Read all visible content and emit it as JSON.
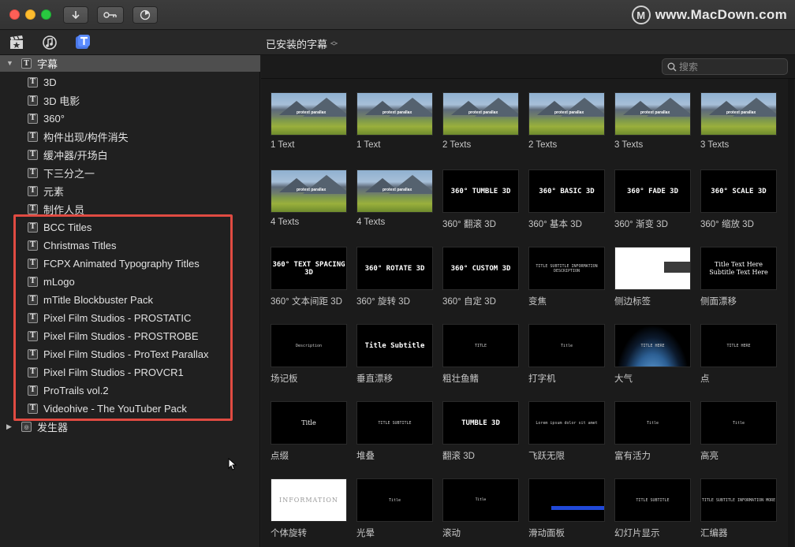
{
  "window": {
    "brand_logo": "M",
    "brand_text": "www.MacDown.com"
  },
  "toolbar": {
    "icons": [
      "download-arrow-icon",
      "key-icon",
      "progress-dial-icon"
    ],
    "tab_icons": [
      "clapperboard-icon",
      "music-notes-icon",
      "titles-icon"
    ],
    "category": "已安装的字幕"
  },
  "search": {
    "placeholder": "搜索"
  },
  "sidebar": {
    "header": "字幕",
    "items": [
      "3D",
      "3D 电影",
      "360°",
      "构件出现/构件消失",
      "缓冲器/开场白",
      "下三分之一",
      "元素",
      "制作人员",
      "BCC Titles",
      "Christmas Titles",
      "FCPX Animated Typography Titles",
      "mLogo",
      "mTitle Blockbuster Pack",
      "Pixel Film Studios - PROSTATIC",
      "Pixel Film Studios - PROSTROBE",
      "Pixel Film Studios - ProText Parallax",
      "Pixel Film Studios - PROVCR1",
      "ProTrails vol.2",
      "Videohive - The YouTuber Pack"
    ],
    "generators": "发生器"
  },
  "tiles": [
    {
      "label": "1 Text",
      "kind": "land",
      "caption": "protext parallax"
    },
    {
      "label": "1 Text",
      "kind": "land",
      "caption": "protext parallax"
    },
    {
      "label": "2 Texts",
      "kind": "land",
      "caption": "protext parallax"
    },
    {
      "label": "2 Texts",
      "kind": "land",
      "caption": "protext parallax"
    },
    {
      "label": "3 Texts",
      "kind": "land",
      "caption": "protext parallax"
    },
    {
      "label": "3 Texts",
      "kind": "land",
      "caption": "protext parallax"
    },
    {
      "label": "4 Texts",
      "kind": "land",
      "caption": "protext parallax"
    },
    {
      "label": "4 Texts",
      "kind": "land",
      "caption": "protext parallax"
    },
    {
      "label": "360° 翻滚 3D",
      "kind": "text",
      "caption": "360° TUMBLE 3D"
    },
    {
      "label": "360° 基本 3D",
      "kind": "text",
      "caption": "360° BASIC 3D"
    },
    {
      "label": "360° 渐变 3D",
      "kind": "text",
      "caption": "360° FADE 3D"
    },
    {
      "label": "360° 缩放 3D",
      "kind": "text",
      "caption": "360° SCALE 3D"
    },
    {
      "label": "360° 文本间距 3D",
      "kind": "text",
      "caption": "360° TEXT SPACING 3D"
    },
    {
      "label": "360° 旋转 3D",
      "kind": "text",
      "caption": "360° ROTATE 3D"
    },
    {
      "label": "360° 自定 3D",
      "kind": "text",
      "caption": "360° CUSTOM 3D"
    },
    {
      "label": "变焦",
      "kind": "small",
      "caption": "TITLE SUBTITLE INFORMATION DESCRIPTION"
    },
    {
      "label": "侧边标签",
      "kind": "white",
      "caption": ""
    },
    {
      "label": "侧面漂移",
      "kind": "serif",
      "caption": "Title Text Here Subtitle Text Here"
    },
    {
      "label": "场记板",
      "kind": "small",
      "caption": "Description"
    },
    {
      "label": "垂直漂移",
      "kind": "text",
      "caption": "Title Subtitle"
    },
    {
      "label": "粗壮鱼鳍",
      "kind": "small",
      "caption": "TITLE"
    },
    {
      "label": "打字机",
      "kind": "small",
      "caption": "Title"
    },
    {
      "label": "大气",
      "kind": "globe",
      "caption": "TITLE HERE"
    },
    {
      "label": "点",
      "kind": "small",
      "caption": "TITLE HERE"
    },
    {
      "label": "点缀",
      "kind": "serif",
      "caption": "Title"
    },
    {
      "label": "堆叠",
      "kind": "small",
      "caption": "TITLE SUBTITLE"
    },
    {
      "label": "翻滚 3D",
      "kind": "text",
      "caption": "TUMBLE 3D"
    },
    {
      "label": "飞跃无限",
      "kind": "small",
      "caption": "Lorem ipsum dolor sit amet"
    },
    {
      "label": "富有活力",
      "kind": "small",
      "caption": "Title"
    },
    {
      "label": "高亮",
      "kind": "small",
      "caption": "Title"
    },
    {
      "label": "个体旋转",
      "kind": "info",
      "caption": "INFORMATION"
    },
    {
      "label": "光晕",
      "kind": "small",
      "caption": "Title"
    },
    {
      "label": "滚动",
      "kind": "credits",
      "caption": "Title"
    },
    {
      "label": "滑动面板",
      "kind": "blue",
      "caption": ""
    },
    {
      "label": "幻灯片显示",
      "kind": "small",
      "caption": "TITLE SUBTITLE"
    },
    {
      "label": "汇编器",
      "kind": "small",
      "caption": "TITLE SUBTITLE INFORMATION MORE"
    }
  ]
}
